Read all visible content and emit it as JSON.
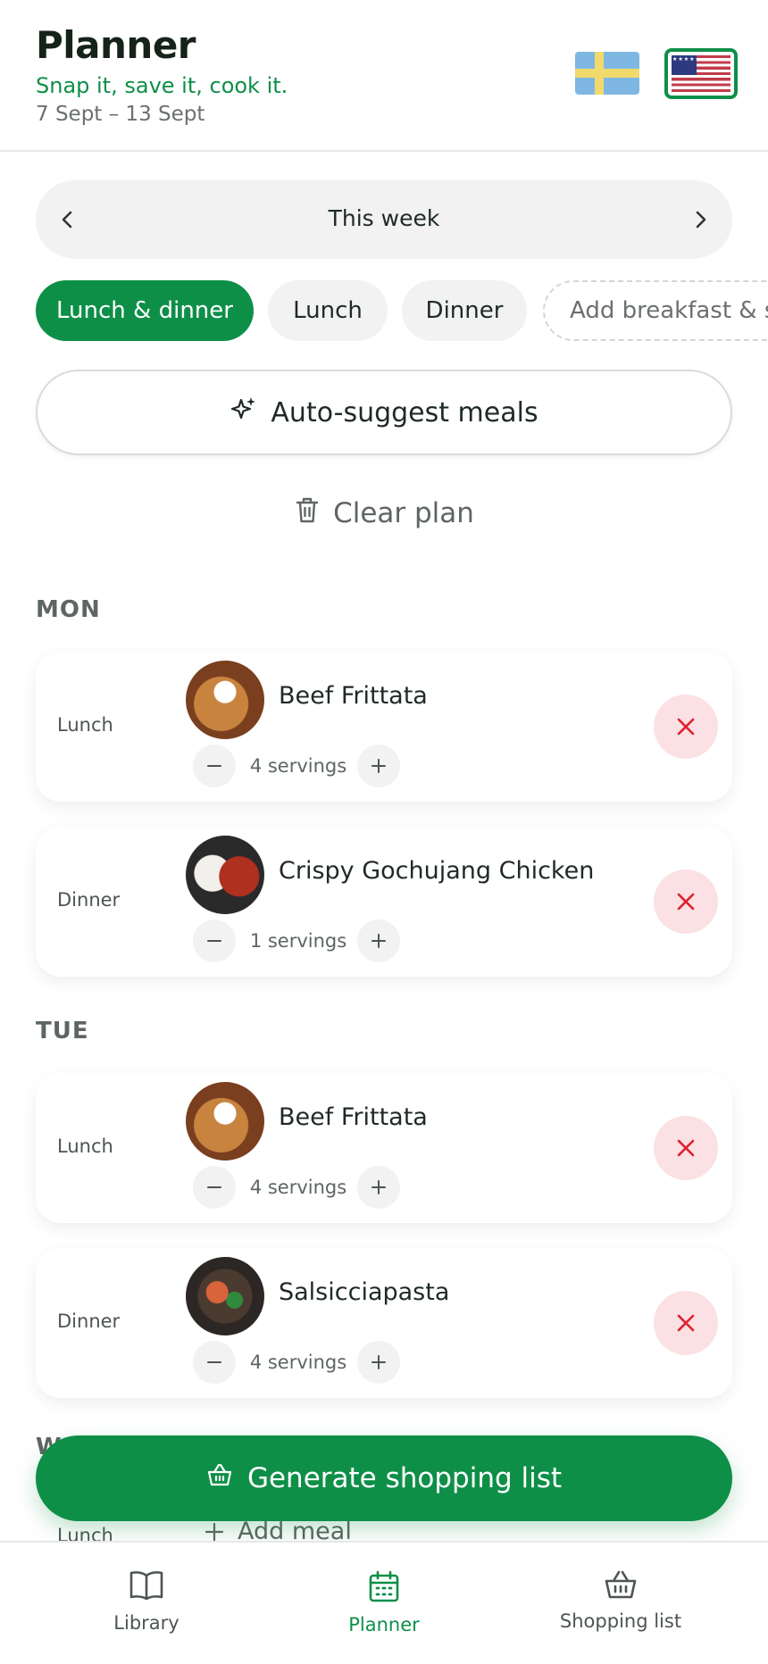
{
  "header": {
    "title": "Planner",
    "tagline": "Snap it, save it, cook it.",
    "date_range": "7 Sept – 13 Sept",
    "languages": [
      {
        "icon": "flag-sweden-icon",
        "selected": false
      },
      {
        "icon": "flag-usa-icon",
        "selected": true
      }
    ]
  },
  "week_nav": {
    "label": "This week",
    "prev_icon": "chevron-left-icon",
    "next_icon": "chevron-right-icon"
  },
  "filters": {
    "chips": [
      "Lunch & dinner",
      "Lunch",
      "Dinner",
      "Add breakfast & sn"
    ],
    "active": "Lunch & dinner"
  },
  "actions": {
    "auto_suggest": "Auto-suggest meals",
    "clear_plan": "Clear plan"
  },
  "days": [
    {
      "label": "MON",
      "meals": [
        {
          "type": "Lunch",
          "name": "Beef Frittata",
          "servings": "4 servings"
        },
        {
          "type": "Dinner",
          "name": "Crispy Gochujang Chicken",
          "servings": "1 servings"
        }
      ]
    },
    {
      "label": "TUE",
      "meals": [
        {
          "type": "Lunch",
          "name": "Beef Frittata",
          "servings": "4 servings"
        },
        {
          "type": "Dinner",
          "name": "Salsicciapasta",
          "servings": "4 servings"
        }
      ]
    }
  ],
  "partial_day": {
    "label": "W",
    "meal_type": "Lunch",
    "add_meal": "Add meal"
  },
  "generate_button": "Generate shopping list",
  "bottom_nav": {
    "items": [
      {
        "label": "Library",
        "icon": "book-icon"
      },
      {
        "label": "Planner",
        "icon": "calendar-icon",
        "active": true
      },
      {
        "label": "Shopping list",
        "icon": "basket-icon"
      }
    ]
  },
  "colors": {
    "accent": "#0e8f48",
    "danger": "#e0202f",
    "danger_bg": "#fbe1e3",
    "chip_bg": "#f1f2f1"
  }
}
